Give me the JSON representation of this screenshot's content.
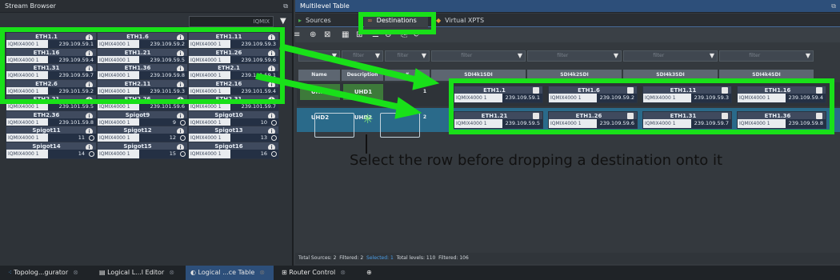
{
  "left_panel": {
    "title": "Stream Browser",
    "search": "IQMIX"
  },
  "tiles": [
    {
      "name": "ETH1.1",
      "device": "IQMIX4000 1",
      "value": "239.109.59.1"
    },
    {
      "name": "ETH1.6",
      "device": "IQMIX4000 1",
      "value": "239.109.59.2"
    },
    {
      "name": "ETH1.11",
      "device": "IQMIX4000 1",
      "value": "239.109.59.3"
    },
    {
      "name": "ETH1.16",
      "device": "IQMIX4000 1",
      "value": "239.109.59.4"
    },
    {
      "name": "ETH1.21",
      "device": "IQMIX4000 1",
      "value": "239.109.59.5"
    },
    {
      "name": "ETH1.26",
      "device": "IQMIX4000 1",
      "value": "239.109.59.6"
    },
    {
      "name": "ETH1.31",
      "device": "IQMIX4000 1",
      "value": "239.109.59.7"
    },
    {
      "name": "ETH1.36",
      "device": "IQMIX4000 1",
      "value": "239.109.59.8"
    },
    {
      "name": "ETH2.1",
      "device": "IQMIX4000 1",
      "value": "239.101.59.1"
    },
    {
      "name": "ETH2.6",
      "device": "IQMIX4000 1",
      "value": "239.101.59.2"
    },
    {
      "name": "ETH2.11",
      "device": "IQMIX4000 1",
      "value": "239.101.59.3"
    },
    {
      "name": "ETH2.16",
      "device": "IQMIX4000 1",
      "value": "239.101.59.4"
    },
    {
      "name": "ETH2.21",
      "device": "IQMIX4000 1",
      "value": "239.101.59.5"
    },
    {
      "name": "ETH2.26",
      "device": "IQMIX4000 1",
      "value": "239.101.59.6"
    },
    {
      "name": "ETH2.31",
      "device": "IQMIX4000 1",
      "value": "239.101.59.7"
    },
    {
      "name": "ETH2.36",
      "device": "IQMIX4000 1",
      "value": "239.101.59.8"
    },
    {
      "name": "Spigot9",
      "device": "IQMIX4000 1",
      "value": "9"
    },
    {
      "name": "Spigot10",
      "device": "IQMIX4000 1",
      "value": "10"
    },
    {
      "name": "Spigot11",
      "device": "IQMIX4000 1",
      "value": "11"
    },
    {
      "name": "Spigot12",
      "device": "IQMIX4000 1",
      "value": "12"
    },
    {
      "name": "Spigot13",
      "device": "IQMIX4000 1",
      "value": "13"
    },
    {
      "name": "Spigot14",
      "device": "IQMIX4000 1",
      "value": "14"
    },
    {
      "name": "Spigot15",
      "device": "IQMIX4000 1",
      "value": "15"
    },
    {
      "name": "Spigot16",
      "device": "IQMIX4000 1",
      "value": "16"
    }
  ],
  "right_panel": {
    "title": "Multilevel Table",
    "tabs": [
      "Sources",
      "Destinations",
      "Virtual XPTS"
    ],
    "filter_placeholder": "filter",
    "columns": [
      "Name",
      "Description",
      "#",
      "SDI4k1SDI",
      "SDI4k2SDI",
      "SDI4k3SDI",
      "SDI4k4SDI"
    ],
    "rows": [
      {
        "name": "UHD1",
        "description": "UHD1",
        "num": "1",
        "dests": [
          {
            "name": "ETH1.1",
            "device": "IQMIX4000 1",
            "value": "239.109.59.1"
          },
          {
            "name": "ETH1.6",
            "device": "IQMIX4000 1",
            "value": "239.109.59.2"
          },
          {
            "name": "ETH1.11",
            "device": "IQMIX4000 1",
            "value": "239.109.59.3"
          },
          {
            "name": "ETH1.16",
            "device": "IQMIX4000 1",
            "value": "239.109.59.4"
          }
        ]
      },
      {
        "name": "UHD2",
        "description": "UHD2",
        "num": "2",
        "dests": [
          {
            "name": "ETH1.21",
            "device": "IQMIX4000 1",
            "value": "239.109.59.5"
          },
          {
            "name": "ETH1.26",
            "device": "IQMIX4000 1",
            "value": "239.109.59.6"
          },
          {
            "name": "ETH1.31",
            "device": "IQMIX4000 1",
            "value": "239.109.59.7"
          },
          {
            "name": "ETH1.36",
            "device": "IQMIX4000 1",
            "value": "239.109.59.8"
          }
        ]
      }
    ],
    "status": {
      "sources": "Total Sources: 2",
      "filtered": "Filtered: 2",
      "selected": "Selected: 1",
      "levels": "Total levels: 110",
      "levels_filtered": "Filtered: 106"
    }
  },
  "bottom_tabs": [
    "Topolog...gurator",
    "Logical L...l Editor",
    "Logical ...ce Table",
    "Router Control"
  ],
  "annotation": "Select the row before dropping a destination onto it",
  "colors": {
    "highlight": "#19e019",
    "selected_row": "#2a6a8a",
    "uhd1_row": "#3d7a3a",
    "tile": "#3f4a5e"
  }
}
